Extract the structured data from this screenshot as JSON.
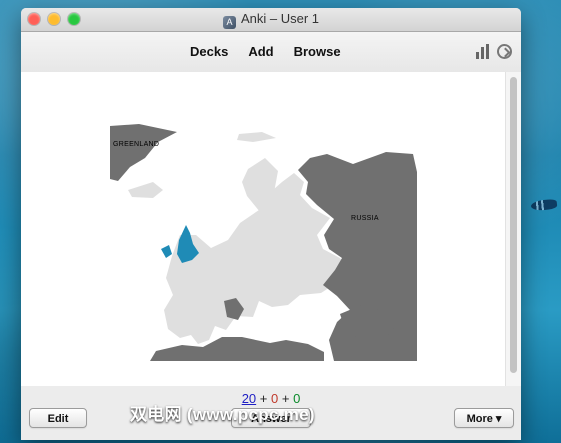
{
  "window": {
    "title": "Anki – User 1"
  },
  "toolbar": {
    "decks": "Decks",
    "add": "Add",
    "browse": "Browse",
    "icons": [
      "stats-icon",
      "sync-icon"
    ]
  },
  "map": {
    "labels": {
      "greenland": "GREENLAND",
      "russia": "RUSSIA"
    },
    "colors": {
      "ocean": "#ffffff",
      "europe": "#dfdfdf",
      "other_land": "#707070",
      "highlight": "#1f8bb6"
    }
  },
  "study_counts": {
    "new": "20",
    "learning": "0",
    "review": "0",
    "separator": "+"
  },
  "buttons": {
    "edit": "Edit",
    "answer": "Answer",
    "more": "More ▾"
  },
  "watermark": "双电网 (www.pcpc.me)"
}
